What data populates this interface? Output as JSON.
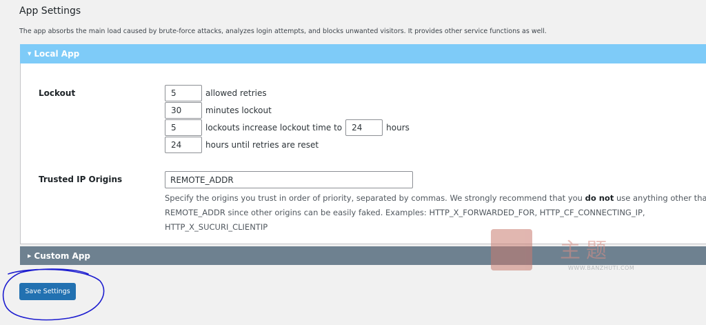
{
  "page": {
    "title": "App Settings",
    "description": "The app absorbs the main load caused by brute-force attacks, analyzes login attempts, and blocks unwanted visitors. It provides other service functions as well."
  },
  "local_app": {
    "header": "Local App",
    "lockout": {
      "label": "Lockout",
      "allowed_retries": {
        "value": "5",
        "suffix": "allowed retries"
      },
      "minutes_lockout": {
        "value": "30",
        "suffix": "minutes lockout"
      },
      "lockouts_increase": {
        "value": "5",
        "middle": "lockouts increase lockout time to",
        "hours_value": "24",
        "suffix": "hours"
      },
      "hours_until_reset": {
        "value": "24",
        "suffix": "hours until retries are reset"
      }
    },
    "trusted_ip": {
      "label": "Trusted IP Origins",
      "value": "REMOTE_ADDR",
      "help_line1_before": "Specify the origins you trust in order of priority, separated by commas. We strongly recommend that you",
      "help_line1_bold": "do not",
      "help_line1_after": "use anything other than",
      "help_line2": "REMOTE_ADDR since other origins can be easily faked. Examples: HTTP_X_FORWARDED_FOR, HTTP_CF_CONNECTING_IP,",
      "help_line3": "HTTP_X_SUCURI_CLIENTIP"
    }
  },
  "custom_app": {
    "header": "Custom App"
  },
  "actions": {
    "save_label": "Save Settings"
  },
  "watermark": {
    "text": "主题",
    "url": "WWW.BANZHUTI.COM"
  },
  "colors": {
    "local_header": "#7ecbf8",
    "custom_header": "#6e8190",
    "primary_button": "#2271b1",
    "annotation": "#1c1ccf"
  },
  "icons": {
    "expanded_caret": "caret-down-icon",
    "collapsed_caret": "caret-right-icon"
  }
}
